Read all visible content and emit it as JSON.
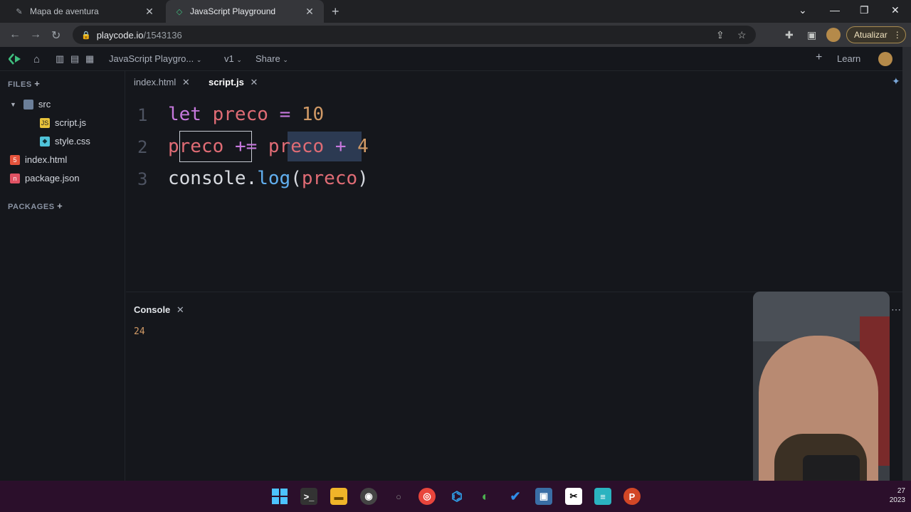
{
  "browser": {
    "tabs": [
      {
        "title": "Mapa de aventura",
        "active": false
      },
      {
        "title": "JavaScript Playground",
        "active": true
      }
    ],
    "address": {
      "host": "playcode.io",
      "path": "/1543136"
    },
    "update_label": "Atualizar"
  },
  "playcode": {
    "project_title": "JavaScript Playgro...",
    "version": "v1",
    "share_label": "Share",
    "learn_label": "Learn"
  },
  "sidebar": {
    "files_title": "FILES",
    "packages_title": "PACKAGES",
    "items": [
      {
        "label": "src",
        "icon": "folder-icon"
      },
      {
        "label": "script.js",
        "icon": "js-file-icon"
      },
      {
        "label": "style.css",
        "icon": "css-file-icon"
      },
      {
        "label": "index.html",
        "icon": "html-file-icon"
      },
      {
        "label": "package.json",
        "icon": "json-file-icon"
      }
    ]
  },
  "editor": {
    "tabs": [
      {
        "label": "index.html",
        "active": false
      },
      {
        "label": "script.js",
        "active": true
      }
    ],
    "line_numbers": [
      "1",
      "2",
      "3"
    ],
    "lines": [
      {
        "t1": "let",
        "t2": "preco",
        "t3": "=",
        "t4": "10"
      },
      {
        "t1": "preco",
        "t2": "+=",
        "t3": "preco",
        "t4": "+",
        "t5": "4"
      },
      {
        "t1": "console",
        "t2": ".",
        "t3": "log",
        "t4": "(",
        "t5": "preco",
        "t6": ")"
      }
    ]
  },
  "console": {
    "title": "Console",
    "output": "24"
  },
  "taskbar": {
    "clock_time": "27",
    "clock_year": "2023"
  },
  "colors": {
    "keyword": "#c678dd",
    "variable": "#e06c75",
    "number": "#d19a66",
    "function": "#61afef",
    "taskbar": "#2b0f2b"
  }
}
